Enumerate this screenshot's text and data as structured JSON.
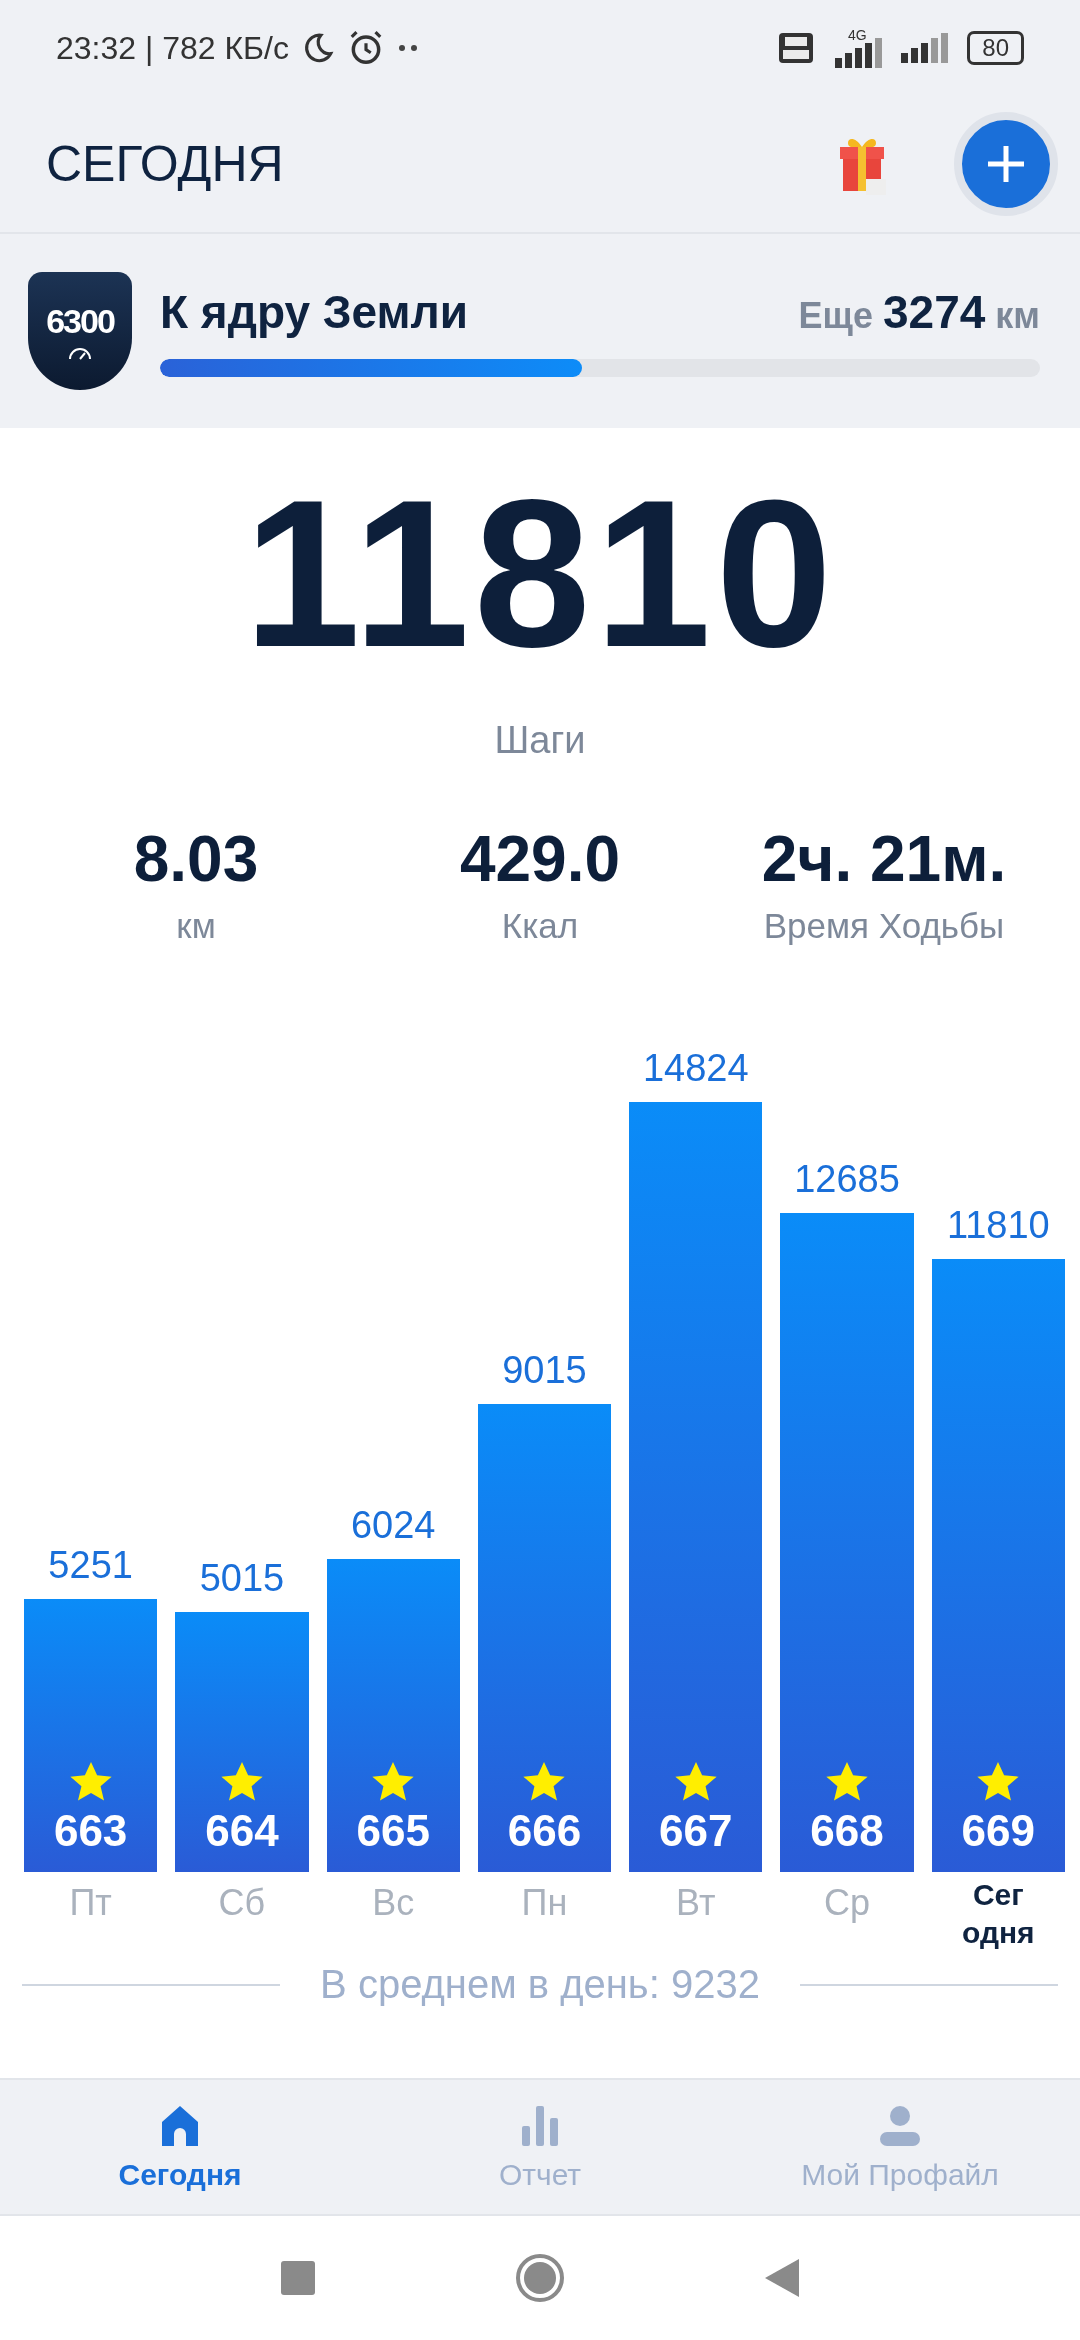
{
  "status_bar": {
    "time": "23:32 | 782 КБ/с",
    "network": "4G",
    "battery": "80"
  },
  "header": {
    "title": "СЕГОДНЯ"
  },
  "goal": {
    "badge": "6300",
    "title": "К ядру Земли",
    "remaining_label": "Еще",
    "remaining_value": "3274",
    "remaining_unit": "км",
    "level": 0.48
  },
  "steps": {
    "value": "11810",
    "label": "Шаги"
  },
  "stats": [
    {
      "value": "8.03",
      "label": "км"
    },
    {
      "value": "429.0",
      "label": "Ккал"
    },
    {
      "value": "2ч. 21м.",
      "label": "Время Ходьбы"
    }
  ],
  "chart_data": {
    "type": "bar",
    "categories": [
      "Пт",
      "Сб",
      "Вс",
      "Пн",
      "Вт",
      "Ср",
      "Сег одня"
    ],
    "values": [
      5251,
      5015,
      6024,
      9015,
      14824,
      12685,
      11810
    ],
    "data_labels": true
  },
  "days": [
    {
      "badge": "663",
      "selected": false
    },
    {
      "badge": "664",
      "selected": false
    },
    {
      "badge": "665",
      "selected": false
    },
    {
      "badge": "666",
      "selected": false
    },
    {
      "badge": "667",
      "selected": false
    },
    {
      "badge": "668",
      "selected": false
    },
    {
      "badge": "669",
      "selected": true
    }
  ],
  "average": "В среднем в день: 9232",
  "nav": [
    {
      "kind": "home",
      "label": "Сегодня",
      "selected": true
    },
    {
      "kind": "report",
      "label": "Отчет",
      "selected": false
    },
    {
      "kind": "profile",
      "label": "Мой Профайл",
      "selected": false
    }
  ]
}
